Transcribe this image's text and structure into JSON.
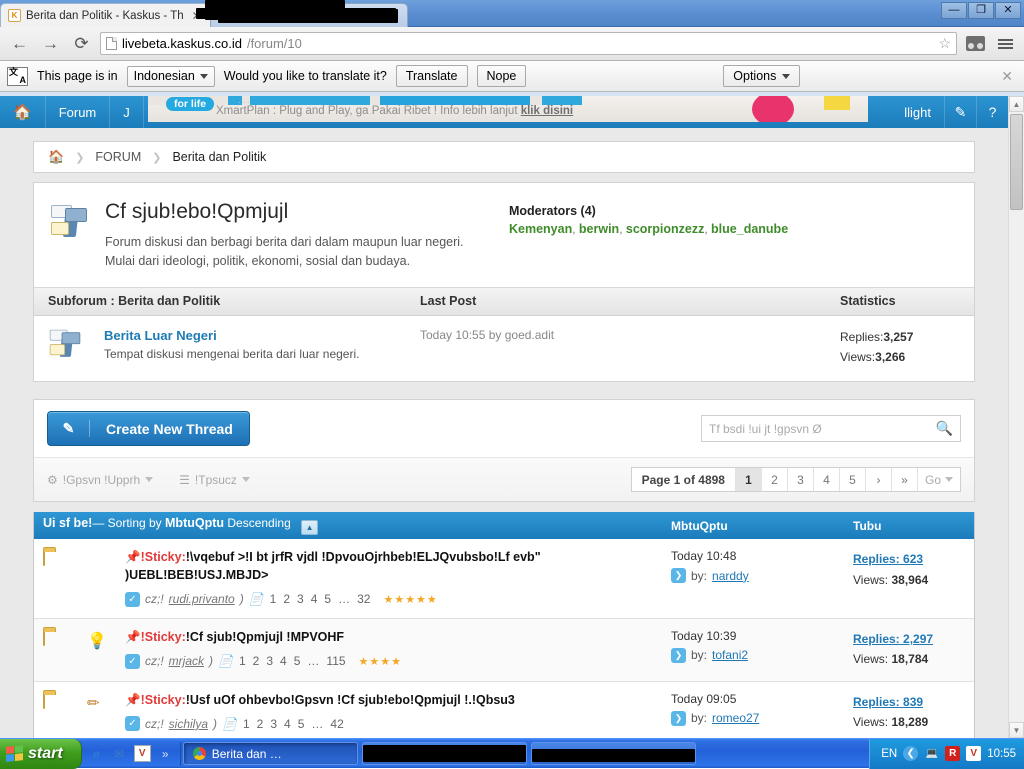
{
  "browser": {
    "tabs": [
      {
        "title": "Berita dan Politik - Kaskus - Th",
        "favicon": "kaskus-favicon",
        "active": true
      },
      {
        "title": "",
        "favicon": "",
        "active": false,
        "redacted": true
      }
    ],
    "window_controls": {
      "minimize": "—",
      "maximize": "❐",
      "close": "✕"
    },
    "nav": {
      "back": "←",
      "forward": "→",
      "reload": "⟳"
    },
    "omnibox": {
      "host": "livebeta.kaskus.co.id",
      "path": "/forum/10",
      "star": "☆"
    },
    "translate_bar": {
      "prefix": "This page is in",
      "language": "Indonesian",
      "question": "Would you like to translate it?",
      "translate_label": "Translate",
      "nope_label": "Nope",
      "options_label": "Options",
      "close": "✕"
    }
  },
  "site_nav": {
    "home_icon": "home-icon",
    "items": [
      "Forum",
      "J"
    ],
    "right_items": [
      "llight"
    ],
    "edit_icon": "✎",
    "help_icon": "?"
  },
  "ad": {
    "badge": "for life",
    "text": "XmartPlan : Plug and Play, ga Pakai Ribet ! Info lebih lanjut ",
    "link": "klik disini"
  },
  "breadcrumb": {
    "home_icon": "home-icon",
    "items": [
      "FORUM",
      "Berita dan Politik"
    ]
  },
  "forum_header": {
    "title": "Cf sjub!ebo!Qpmjujl",
    "description": "Forum diskusi dan berbagi berita dari dalam maupun luar negeri. Mulai dari ideologi, politik, ekonomi, sosial dan budaya.",
    "moderators_label": "Moderators (4)",
    "moderators": [
      "Kemenyan",
      "berwin",
      "scorpionzezz",
      "blue_danube"
    ]
  },
  "subforum_table": {
    "headers": {
      "name": "Subforum : Berita dan Politik",
      "last_post": "Last Post",
      "statistics": "Statistics"
    },
    "rows": [
      {
        "name": "Berita Luar Negeri",
        "description": "Tempat diskusi mengenai berita dari luar negeri.",
        "last_post": "Today 10:55 by goed.adit",
        "replies_label": "Replies:",
        "replies": "3,257",
        "views_label": "Views:",
        "views": "3,266"
      }
    ]
  },
  "actions": {
    "create_thread_label": "Create New Thread",
    "create_thread_icon": "pencil-icon",
    "search_placeholder": "Tf bsdi !ui jt !gpsvn Ø",
    "search_icon": "search-icon",
    "forum_tools_label": "!Gpsvn !Upprh",
    "sort_by_label": "!Tpsucz",
    "pagination": {
      "page_info": "Page 1 of 4898",
      "pages": [
        "1",
        "2",
        "3",
        "4",
        "5"
      ],
      "current": "1",
      "next": "›",
      "last": "»",
      "go_label": "Go"
    }
  },
  "thread_table": {
    "header": {
      "title_col": "Ui sf be!",
      "sorting_text": "— Sorting by ",
      "sort_field": "MbtuQptu",
      "sort_dir": " Descending",
      "sort_toggle_icon": "caret-up-icon",
      "last_post_col": "MbtuQptu",
      "stats_col": "Tubu"
    },
    "rows": [
      {
        "folder_icon": "folder-icon",
        "second_icon": "",
        "pin_icon": "📌",
        "sticky_label": "!Sticky:",
        "title_line1": "!\\vqebuf ˃!I bt jrfR vjdl !DpvouOjrhbeb!ELJQvubsbo!Lf evb\"",
        "title_line2": ")UEBL!BEB!USJ.MBJD˃",
        "by_prefix": "cz;!",
        "author": "rudi.privanto",
        "after_author": ")",
        "page_links": [
          "1",
          "2",
          "3",
          "4",
          "5"
        ],
        "ellipsis": "…",
        "last_page": "32",
        "stars": 5,
        "last_post_time": "Today 10:48",
        "by_label": "by:",
        "last_poster": "narddy",
        "replies_label": "Replies:",
        "replies": "623",
        "views_label": "Views:",
        "views": "38,964"
      },
      {
        "folder_icon": "folder-icon",
        "second_icon": "bulb-icon",
        "pin_icon": "📌",
        "sticky_label": "!Sticky:",
        "title_line1": "!Cf sjub!Qpmjujl !MPVOHF",
        "title_line2": "",
        "by_prefix": "cz;!",
        "author": "mrjack",
        "after_author": ")",
        "page_links": [
          "1",
          "2",
          "3",
          "4",
          "5"
        ],
        "ellipsis": "…",
        "last_page": "115",
        "stars": 4,
        "last_post_time": "Today 10:39",
        "by_label": "by:",
        "last_poster": "tofani2",
        "replies_label": "Replies:",
        "replies": "2,297",
        "views_label": "Views:",
        "views": "18,784"
      },
      {
        "folder_icon": "folder-icon",
        "second_icon": "pencil-icon",
        "pin_icon": "📌",
        "sticky_label": "!Sticky:",
        "title_line1": "!Usf uOf ohbevbo!Gpsvn !Cf sjub!ebo!Qpmjujl !.!Qbsu3",
        "title_line2": "",
        "by_prefix": "cz;!",
        "author": "sichilya",
        "after_author": ")",
        "page_links": [
          "1",
          "2",
          "3",
          "4",
          "5"
        ],
        "ellipsis": "…",
        "last_page": "42",
        "stars": 0,
        "last_post_time": "Today 09:05",
        "by_label": "by:",
        "last_poster": "romeo27",
        "replies_label": "Replies:",
        "replies": "839",
        "views_label": "Views:",
        "views": "18,289"
      }
    ]
  },
  "taskbar": {
    "start_label": "start",
    "quick_launch": [
      "ie-icon",
      "outlook-icon",
      "v-icon"
    ],
    "overflow": "»",
    "windows": [
      {
        "label": "Berita dan …",
        "icon": "chrome-icon",
        "active": true
      },
      {
        "label": "",
        "icon": "",
        "redacted": true
      },
      {
        "label": "",
        "icon": "",
        "redacted": true
      }
    ],
    "tray": {
      "language": "EN",
      "clock": "10:55",
      "icons": [
        "show-desktop-icon",
        "network-icon",
        "avira-icon",
        "v-icon"
      ]
    }
  },
  "colors": {
    "accent_blue": "#1c7cbb",
    "link_blue": "#2079b5",
    "moderator_green": "#3f8c2a",
    "sticky_red": "#e03a3a",
    "star_gold": "#f5a623"
  }
}
